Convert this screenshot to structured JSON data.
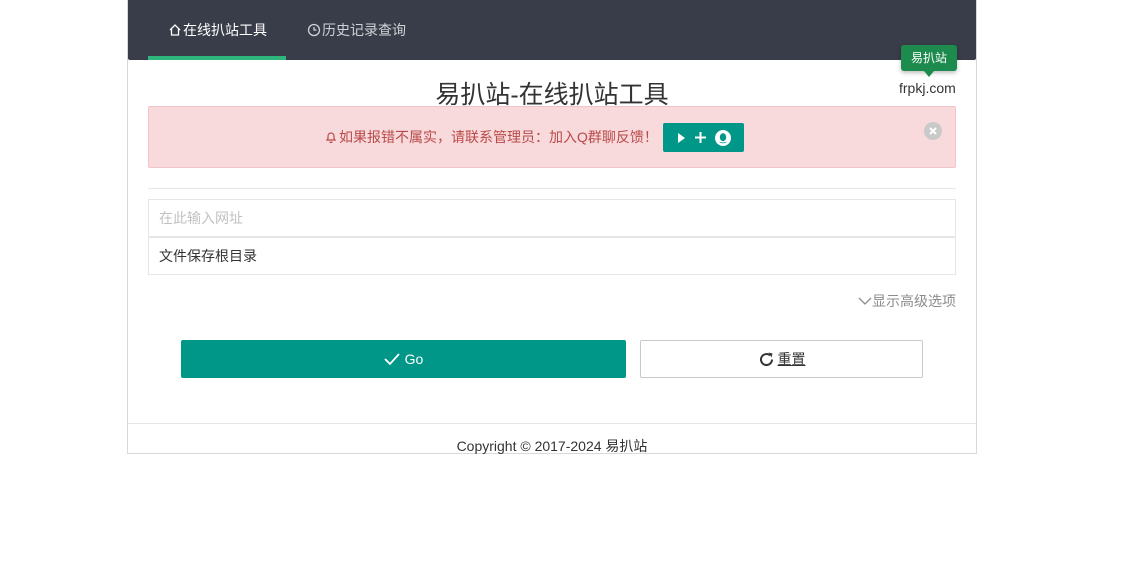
{
  "nav": {
    "tabs": [
      {
        "label": "在线扒站工具",
        "icon": "home-icon",
        "active": true
      },
      {
        "label": "历史记录查询",
        "icon": "clock-icon",
        "active": false
      }
    ],
    "accent_color": "#2eb67d",
    "background_color": "#393d49"
  },
  "brand": {
    "badge": "易扒站",
    "domain": "frpkj.com"
  },
  "page_title": "易扒站-在线扒站工具",
  "alert": {
    "message": "如果报错不属实，请联系管理员：加入Q群聊反馈！",
    "icon": "bell-icon",
    "join_button_icons": [
      "play-icon",
      "plus-icon",
      "qq-icon"
    ],
    "close_icon": "close-circle-icon"
  },
  "form": {
    "url_placeholder": "在此输入网址",
    "url_value": "",
    "dir_value": "文件保存根目录",
    "advanced_toggle": "显示高级选项"
  },
  "actions": {
    "go_label": "Go",
    "reset_label": "重置",
    "primary_color": "#009688"
  },
  "footer": {
    "copyright": "Copyright © 2017-2024 易扒站"
  }
}
